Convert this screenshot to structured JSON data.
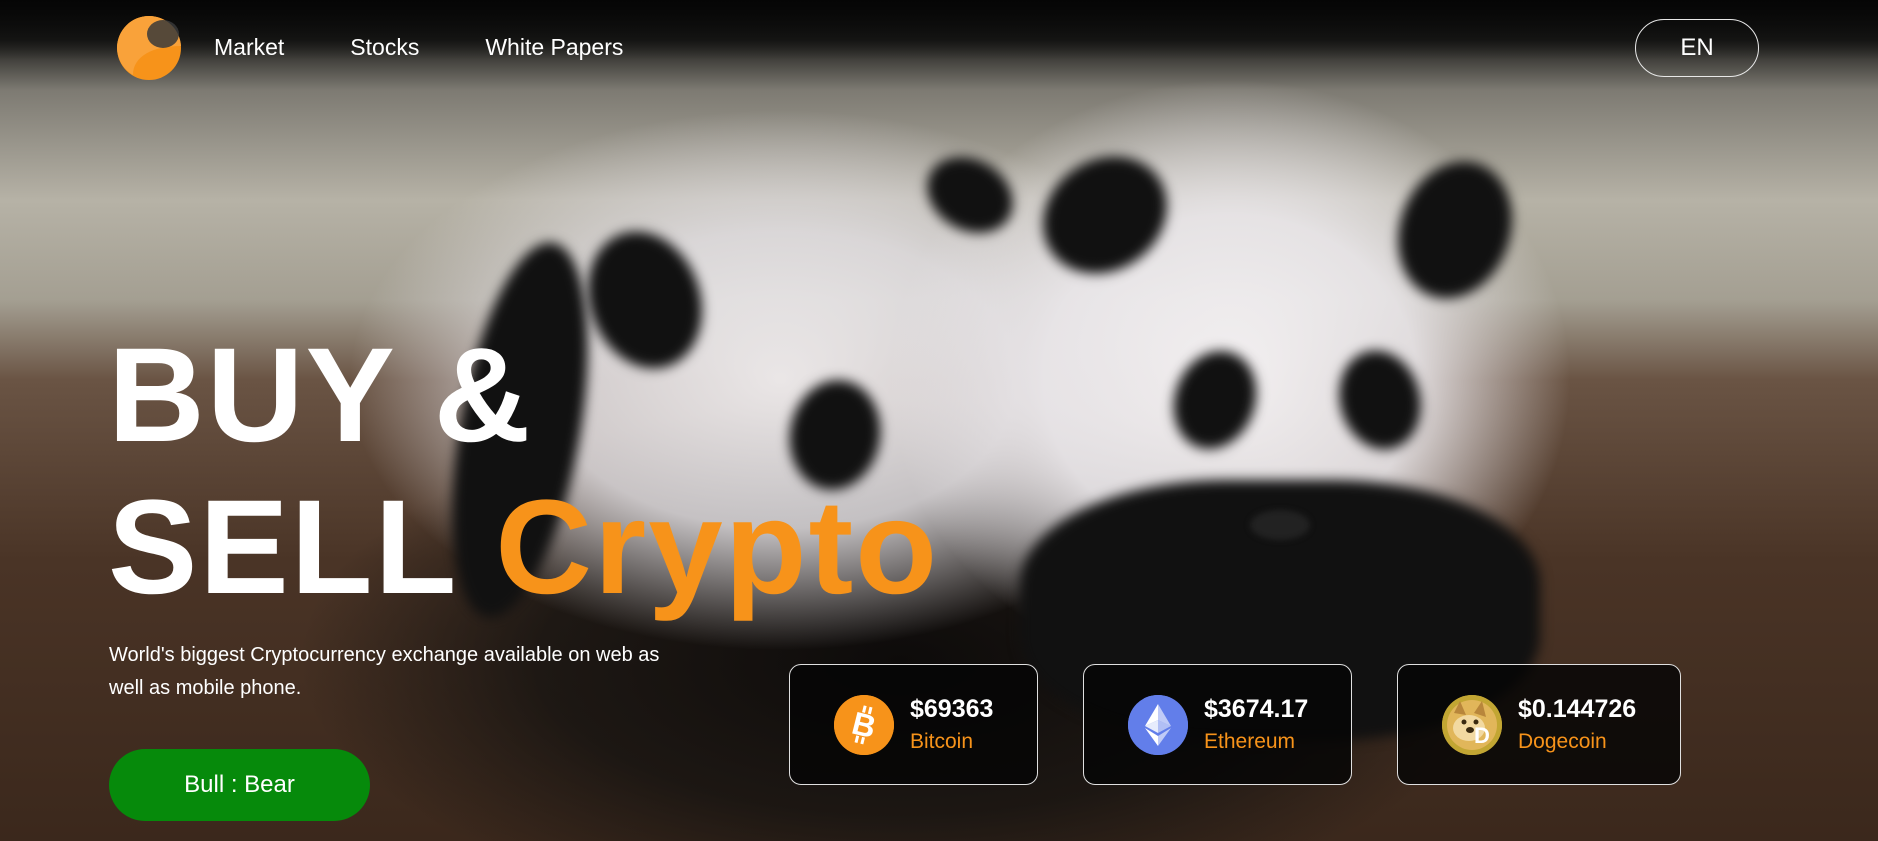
{
  "header": {
    "logo_icon": "crescent-logo-icon",
    "nav": [
      {
        "label": "Market"
      },
      {
        "label": "Stocks"
      },
      {
        "label": "White Papers"
      }
    ],
    "language_label": "EN"
  },
  "hero": {
    "headline_line1": "BUY &",
    "headline_word": "SELL",
    "headline_accent": "Crypto",
    "subtitle": "World's biggest Cryptocurrency exchange available on web as well as mobile phone.",
    "cta_label": "Bull : Bear",
    "background_image": "two panda cubs"
  },
  "coins": [
    {
      "price": "$69363",
      "name": "Bitcoin",
      "icon": "bitcoin-icon"
    },
    {
      "price": "$3674.17",
      "name": "Ethereum",
      "icon": "ethereum-icon"
    },
    {
      "price": "$0.144726",
      "name": "Dogecoin",
      "icon": "dogecoin-icon"
    }
  ],
  "colors": {
    "accent": "#f7931a",
    "cta_green": "#068a0b",
    "bitcoin": "#f7931a",
    "ethereum": "#627eea",
    "dogecoin": "#c2a633"
  }
}
